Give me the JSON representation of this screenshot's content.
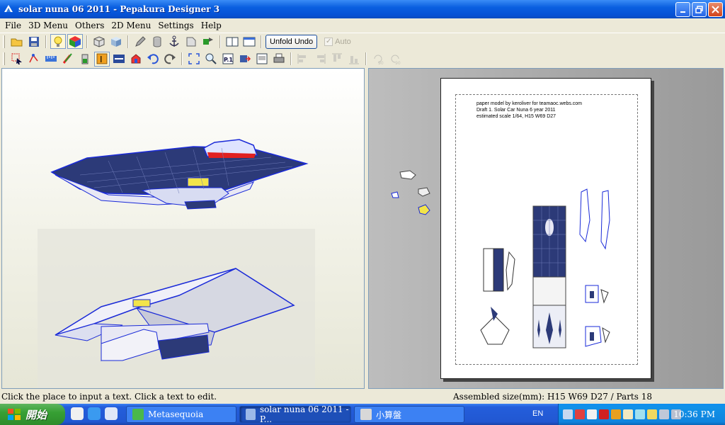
{
  "window": {
    "title": "solar nuna 06 2011 - Pepakura Designer 3"
  },
  "menu": [
    "File",
    "3D Menu",
    "Others",
    "2D Menu",
    "Settings",
    "Help"
  ],
  "toolbar1": {
    "unfold_undo_label": "Unfold Undo",
    "auto_label": "Auto",
    "auto_checked": true
  },
  "paper": {
    "header_lines": [
      "paper model by keroliver for teamaoc.webs.com",
      "Draft 1. Solar Car Nuna 6 year 2011",
      "estimated scale 1/64, H15 W69 D27"
    ]
  },
  "status": {
    "hint": "Click the place to input a text. Click a text to edit.",
    "assembled": "Assembled size(mm): H15  W69  D27 / Parts 18"
  },
  "taskbar": {
    "start_label": "開始",
    "tasks": [
      {
        "label": "Metasequoia",
        "active": false
      },
      {
        "label": "solar nuna 06 2011 - P...",
        "active": true
      },
      {
        "label": "小算盤",
        "active": false
      }
    ],
    "language": "EN",
    "clock": "10:36 PM"
  },
  "colors": {
    "accent": "#0652d6",
    "model_outline": "#1a2ad8",
    "solar_panel": "#27356f"
  }
}
